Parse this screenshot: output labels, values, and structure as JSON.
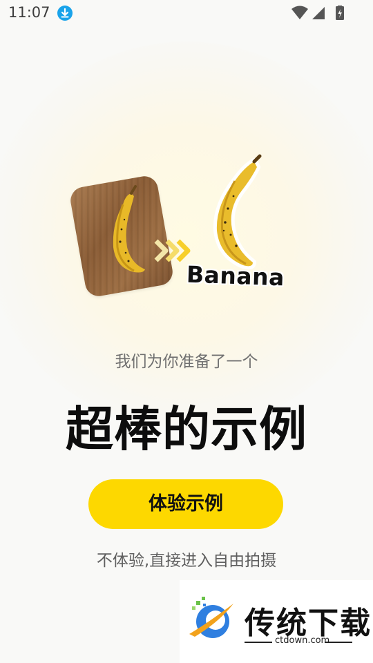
{
  "status_bar": {
    "time": "11:07"
  },
  "illustration": {
    "label": "Banana"
  },
  "onboarding": {
    "subtitle": "我们为你准备了一个",
    "title": "超棒的示例",
    "primary_button": "体验示例",
    "skip_link": "不体验,直接进入自由拍摄"
  },
  "watermark": {
    "name": "传统下载",
    "domain": "ctdown.com"
  },
  "colors": {
    "accent": "#fdd800",
    "download_icon": "#1aa3ea"
  }
}
